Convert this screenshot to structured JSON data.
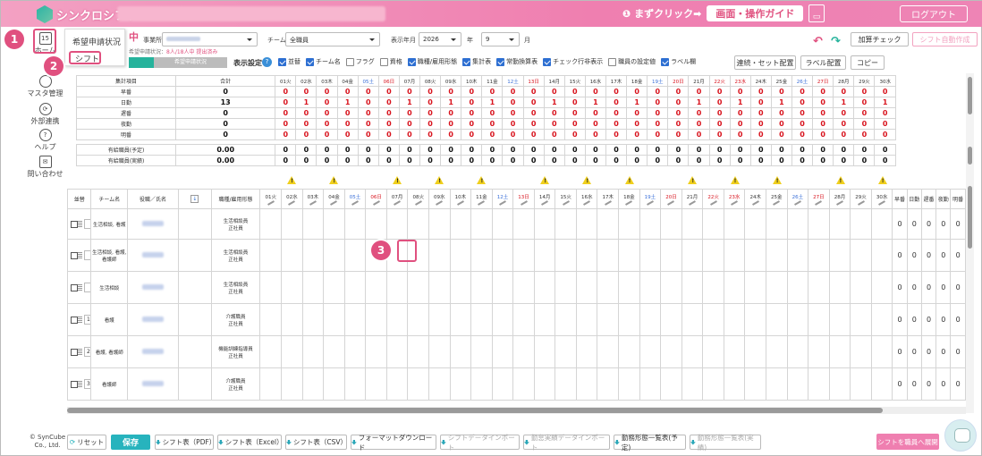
{
  "app": {
    "logo_text": "シンクロシフト"
  },
  "topbar": {
    "guide_hint": "❶ まずクリック➡",
    "guide_button": "画面・操作ガイド",
    "calendar_icon": "calendar-icon",
    "logout": "ログアウト"
  },
  "sidebar": {
    "home": "ホーム",
    "master": "マスタ管理",
    "external": "外部連携",
    "help": "ヘルプ",
    "contact": "問い合わせ"
  },
  "popup": {
    "item1": "希望申請状況",
    "item2": "シフト"
  },
  "steps": [
    "1",
    "2",
    "3"
  ],
  "header": {
    "title_suffix": "中",
    "note_prefix": "希望申請状況：",
    "note_value": "8人/18人中 提出済み",
    "office_label": "事業所",
    "team_label": "チーム",
    "team_value": "全職員",
    "month_label": "表示年月",
    "year_value": "2026",
    "year_unit": "年",
    "month_value": "9",
    "month_unit": "月",
    "tab_label": "希望申請状況",
    "add_check": "加算チェック",
    "auto_create": "シフト自動作成"
  },
  "display_settings": {
    "label": "表示設定",
    "options": [
      {
        "label": "並替",
        "checked": true
      },
      {
        "label": "チーム名",
        "checked": true
      },
      {
        "label": "フラグ",
        "checked": false
      },
      {
        "label": "資格",
        "checked": false
      },
      {
        "label": "職種/雇用形態",
        "checked": true
      },
      {
        "label": "集計表",
        "checked": true
      },
      {
        "label": "常勤換算表",
        "checked": true
      },
      {
        "label": "チェック行非表示",
        "checked": true
      },
      {
        "label": "職員の設定値",
        "checked": false
      },
      {
        "label": "ラベル欄",
        "checked": true
      }
    ],
    "buttons": [
      "連続・セット配置",
      "ラベル配置",
      "コピー"
    ]
  },
  "days": [
    {
      "d": "01",
      "w": "火",
      "t": ""
    },
    {
      "d": "02",
      "w": "水",
      "t": ""
    },
    {
      "d": "03",
      "w": "木",
      "t": ""
    },
    {
      "d": "04",
      "w": "金",
      "t": ""
    },
    {
      "d": "05",
      "w": "土",
      "t": "sat"
    },
    {
      "d": "06",
      "w": "日",
      "t": "sun"
    },
    {
      "d": "07",
      "w": "月",
      "t": ""
    },
    {
      "d": "08",
      "w": "火",
      "t": ""
    },
    {
      "d": "09",
      "w": "水",
      "t": ""
    },
    {
      "d": "10",
      "w": "木",
      "t": ""
    },
    {
      "d": "11",
      "w": "金",
      "t": ""
    },
    {
      "d": "12",
      "w": "土",
      "t": "sat"
    },
    {
      "d": "13",
      "w": "日",
      "t": "sun"
    },
    {
      "d": "14",
      "w": "月",
      "t": ""
    },
    {
      "d": "15",
      "w": "火",
      "t": ""
    },
    {
      "d": "16",
      "w": "水",
      "t": ""
    },
    {
      "d": "17",
      "w": "木",
      "t": ""
    },
    {
      "d": "18",
      "w": "金",
      "t": ""
    },
    {
      "d": "19",
      "w": "土",
      "t": "sat"
    },
    {
      "d": "20",
      "w": "日",
      "t": "sun"
    },
    {
      "d": "21",
      "w": "月",
      "t": ""
    },
    {
      "d": "22",
      "w": "火",
      "t": "sun"
    },
    {
      "d": "23",
      "w": "水",
      "t": "sun"
    },
    {
      "d": "24",
      "w": "木",
      "t": ""
    },
    {
      "d": "25",
      "w": "金",
      "t": ""
    },
    {
      "d": "26",
      "w": "土",
      "t": "sat"
    },
    {
      "d": "27",
      "w": "日",
      "t": "sun"
    },
    {
      "d": "28",
      "w": "月",
      "t": ""
    },
    {
      "d": "29",
      "w": "火",
      "t": ""
    },
    {
      "d": "30",
      "w": "水",
      "t": ""
    }
  ],
  "summary": {
    "head": {
      "item": "集計項目",
      "total": "合計"
    },
    "rows": [
      {
        "label": "早番",
        "total": "0",
        "vals": [
          "0",
          "0",
          "0",
          "0",
          "0",
          "0",
          "0",
          "0",
          "0",
          "0",
          "0",
          "0",
          "0",
          "0",
          "0",
          "0",
          "0",
          "0",
          "0",
          "0",
          "0",
          "0",
          "0",
          "0",
          "0",
          "0",
          "0",
          "0",
          "0",
          "0"
        ]
      },
      {
        "label": "日勤",
        "total": "13",
        "vals": [
          "0",
          "1",
          "0",
          "1",
          "0",
          "0",
          "1",
          "0",
          "1",
          "0",
          "1",
          "0",
          "0",
          "1",
          "0",
          "1",
          "0",
          "1",
          "0",
          "0",
          "1",
          "0",
          "1",
          "0",
          "1",
          "0",
          "0",
          "1",
          "0",
          "1"
        ]
      },
      {
        "label": "遅番",
        "total": "0",
        "vals": [
          "0",
          "0",
          "0",
          "0",
          "0",
          "0",
          "0",
          "0",
          "0",
          "0",
          "0",
          "0",
          "0",
          "0",
          "0",
          "0",
          "0",
          "0",
          "0",
          "0",
          "0",
          "0",
          "0",
          "0",
          "0",
          "0",
          "0",
          "0",
          "0",
          "0"
        ]
      },
      {
        "label": "夜勤",
        "total": "0",
        "vals": [
          "0",
          "0",
          "0",
          "0",
          "0",
          "0",
          "0",
          "0",
          "0",
          "0",
          "0",
          "0",
          "0",
          "0",
          "0",
          "0",
          "0",
          "0",
          "0",
          "0",
          "0",
          "0",
          "0",
          "0",
          "0",
          "0",
          "0",
          "0",
          "0",
          "0"
        ]
      },
      {
        "label": "明番",
        "total": "0",
        "vals": [
          "0",
          "0",
          "0",
          "0",
          "0",
          "0",
          "0",
          "0",
          "0",
          "0",
          "0",
          "0",
          "0",
          "0",
          "0",
          "0",
          "0",
          "0",
          "0",
          "0",
          "0",
          "0",
          "0",
          "0",
          "0",
          "0",
          "0",
          "0",
          "0",
          "0"
        ]
      }
    ],
    "leave_rows": [
      {
        "label": "有給職員(予定)",
        "total": "0.00"
      },
      {
        "label": "有給職員(実績)",
        "total": "0.00"
      }
    ]
  },
  "warn_days": [
    "02",
    "04",
    "07",
    "09",
    "11",
    "14",
    "16",
    "18",
    "21",
    "23",
    "25",
    "28",
    "30"
  ],
  "staff_head": {
    "sort": "並替",
    "team": "チーム名",
    "role": "役職／氏名",
    "job": "職種/雇用形態",
    "tail": [
      "早番",
      "日勤",
      "遅番",
      "夜勤",
      "明番"
    ]
  },
  "staff": [
    {
      "order": "",
      "team": "生活相談, 看護",
      "job": "生活相談員",
      "emp": "正社員"
    },
    {
      "order": "",
      "team": "生活相談, 看護, 看護師",
      "job": "生活相談員",
      "emp": "正社員"
    },
    {
      "order": "",
      "team": "生活相談",
      "job": "生活相談員",
      "emp": "正社員"
    },
    {
      "order": "1",
      "team": "看護",
      "job": "介護職員",
      "emp": "正社員"
    },
    {
      "order": "2",
      "team": "看護, 看護師",
      "job": "機能訓練指導員",
      "emp": "正社員"
    },
    {
      "order": "3",
      "team": "看護師",
      "job": "介護職員",
      "emp": "正社員"
    }
  ],
  "footer": {
    "copyright": "© SynCube Co., Ltd.",
    "reset": "リセット",
    "save": "保存",
    "buttons": [
      {
        "label": "シフト表（PDF）",
        "disabled": false
      },
      {
        "label": "シフト表（Excel）",
        "disabled": false
      },
      {
        "label": "シフト表（CSV）",
        "disabled": false
      },
      {
        "label": "フォーマットダウンロード",
        "disabled": false
      },
      {
        "label": "シフトデータインポート",
        "disabled": true
      },
      {
        "label": "勤怠実績データインポート",
        "disabled": true
      },
      {
        "label": "勤務形態一覧表(予定)",
        "disabled": false
      },
      {
        "label": "勤務形態一覧表(実績)",
        "disabled": true
      }
    ],
    "publish": "シフトを職員へ展開"
  }
}
